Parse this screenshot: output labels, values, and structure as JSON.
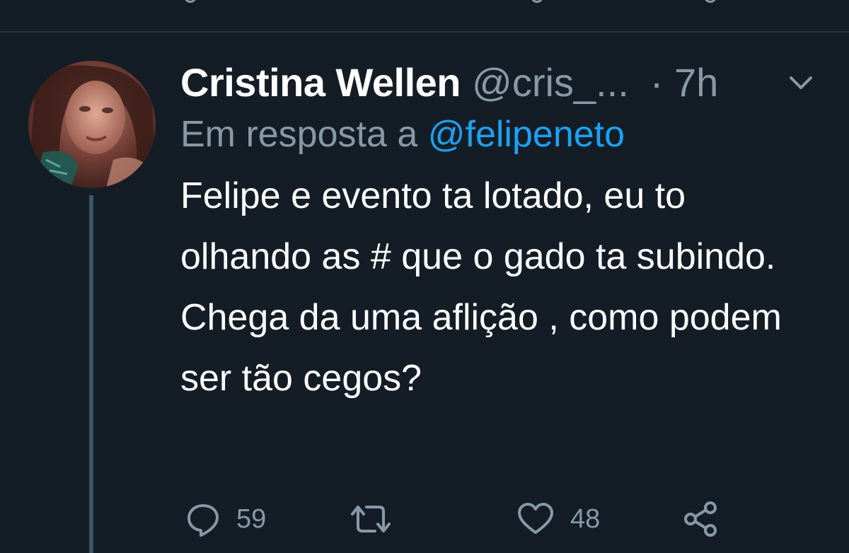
{
  "tweet": {
    "author_name": "Cristina Wellen",
    "author_handle": "@cris_...",
    "time": "· 7h",
    "reply_prefix": "Em resposta a",
    "reply_mention": "@felipeneto",
    "text": "Felipe e evento ta lotado, eu to olhando as # que o gado ta subindo. Chega da uma aflição , como podem ser tão cegos?"
  },
  "actions": {
    "reply_count": "59",
    "retweet_count": "",
    "like_count": "48"
  },
  "icons": {
    "reply": "reply-icon",
    "retweet": "retweet-icon",
    "like": "heart-icon",
    "share": "share-icon",
    "more": "chevron-down-icon"
  },
  "colors": {
    "background": "#141d26",
    "muted": "#8899a6",
    "link": "#1da1f2",
    "text": "#ffffff"
  }
}
